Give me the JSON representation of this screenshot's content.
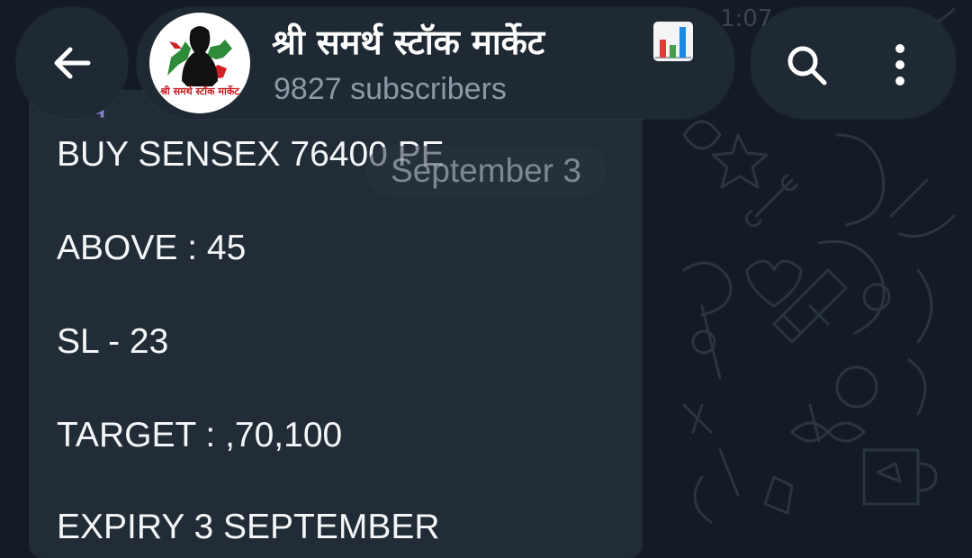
{
  "status_bar": {
    "time": "1:07"
  },
  "header": {
    "back_icon": "arrow-left-icon",
    "channel_name": "श्री समर्थ स्टॉक मार्केट",
    "title_emoji": "bar-chart-icon",
    "avatar_caption": "श्री समर्थ स्टॉक मार्केट",
    "subscribers": "9827 subscribers",
    "search_icon": "search-icon",
    "menu_icon": "more-vertical-icon"
  },
  "date_separator": "September 3",
  "message": {
    "author": "समर्थ",
    "lines": [
      "BUY SENSEX 76400 PE",
      "ABOVE : 45",
      "SL - 23",
      "TARGET : ,70,100",
      "EXPIRY 3 SEPTEMBER"
    ]
  },
  "colors": {
    "background": "#131b24",
    "bubble": "#222c37",
    "header": "#1f2933",
    "text": "#f4f6f8",
    "subtle": "#8c99a6",
    "author": "#8a7fd6"
  }
}
